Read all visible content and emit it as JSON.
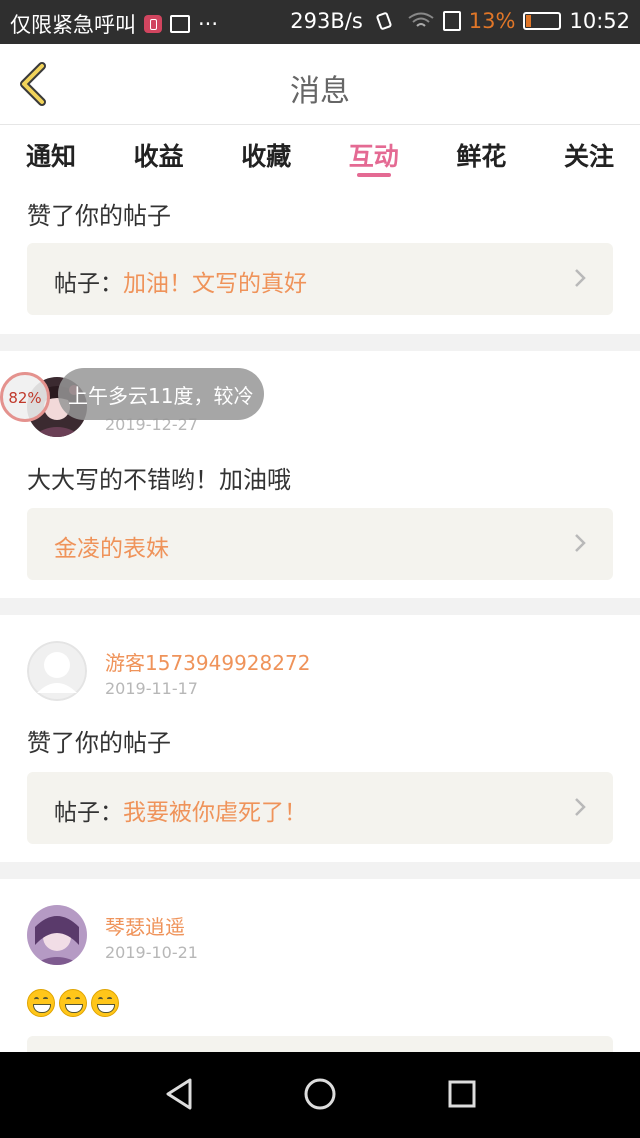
{
  "status_bar": {
    "carrier": "仅限紧急呼叫",
    "more": "···",
    "speed": "293B/s",
    "battery_pct": "13%",
    "time": "10:52",
    "battery_color": "#e07628"
  },
  "header": {
    "title": "消息"
  },
  "tabs": [
    {
      "label": "通知"
    },
    {
      "label": "收益"
    },
    {
      "label": "收藏"
    },
    {
      "label": "互动",
      "active": true
    },
    {
      "label": "鲜花"
    },
    {
      "label": "关注"
    }
  ],
  "feed": [
    {
      "action": "赞了你的帖子",
      "post_prefix": "帖子：",
      "post_title": "加油！文写的真好"
    },
    {
      "username": "",
      "date": "2019-12-27",
      "action": "大大写的不错哟！加油哦",
      "post_prefix": "",
      "post_title": "金凌的表妹"
    },
    {
      "username": "游客1573949928272",
      "date": "2019-11-17",
      "action": "赞了你的帖子",
      "post_prefix": "帖子：",
      "post_title": "我要被你虐死了！"
    },
    {
      "username": "琴瑟逍遥",
      "date": "2019-10-21",
      "emoji": [
        "grin-emoji",
        "grin-emoji",
        "grin-emoji"
      ]
    }
  ],
  "weather_overlay": {
    "text": "上午多云11度，较冷",
    "percent": "82%"
  },
  "colors": {
    "accent": "#e46a93",
    "highlight": "#ef935a",
    "post_bg": "#f4f3ee"
  },
  "icons": {
    "back": "back-chevron-icon",
    "chevron": "chevron-right-icon",
    "nav": [
      "back-triangle-icon",
      "home-circle-icon",
      "recents-square-icon"
    ]
  }
}
